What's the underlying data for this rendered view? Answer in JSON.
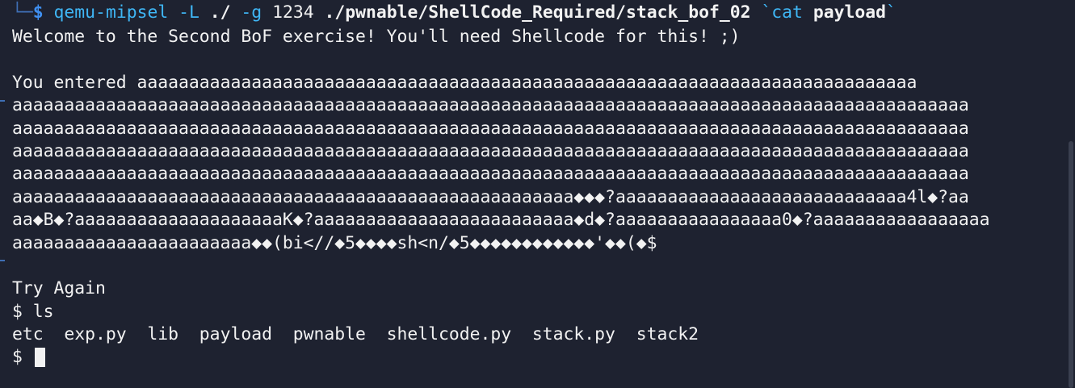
{
  "terminal": {
    "prompt_corner": "└─",
    "prompt_symbol": "$",
    "command": {
      "program": "qemu-mipsel",
      "flag_L": "-L",
      "path_L": "./",
      "flag_g": "-g",
      "port": "1234",
      "binary": "./pwnable/ShellCode_Required/stack_bof_02",
      "backtick_open": "`",
      "sub_cmd": "cat",
      "sub_arg": "payload",
      "backtick_close": "`"
    },
    "output_lines": [
      "Welcome to the Second BoF exercise! You'll need Shellcode for this! ;)",
      "",
      "You entered aaaaaaaaaaaaaaaaaaaaaaaaaaaaaaaaaaaaaaaaaaaaaaaaaaaaaaaaaaaaaaaaaaaaaaaaaaa",
      "aaaaaaaaaaaaaaaaaaaaaaaaaaaaaaaaaaaaaaaaaaaaaaaaaaaaaaaaaaaaaaaaaaaaaaaaaaaaaaaaaaaaaaaaaaaa",
      "aaaaaaaaaaaaaaaaaaaaaaaaaaaaaaaaaaaaaaaaaaaaaaaaaaaaaaaaaaaaaaaaaaaaaaaaaaaaaaaaaaaaaaaaaaaa",
      "aaaaaaaaaaaaaaaaaaaaaaaaaaaaaaaaaaaaaaaaaaaaaaaaaaaaaaaaaaaaaaaaaaaaaaaaaaaaaaaaaaaaaaaaaaaa",
      "aaaaaaaaaaaaaaaaaaaaaaaaaaaaaaaaaaaaaaaaaaaaaaaaaaaaaaaaaaaaaaaaaaaaaaaaaaaaaaaaaaaaaaaaaaaa",
      "aaaaaaaaaaaaaaaaaaaaaaaaaaaaaaaaaaaaaaaaaaaaaaaaaaaaaa◆◆◆?aaaaaaaaaaaaaaaaaaaaaaaaaaaa4l◆?aa",
      "aa◆B◆?aaaaaaaaaaaaaaaaaaaaK◆?aaaaaaaaaaaaaaaaaaaaaaaaa◆d◆?aaaaaaaaaaaaaaaa0◆?aaaaaaaaaaaaaaaaa",
      "aaaaaaaaaaaaaaaaaaaaaaa◆◆(bi<//◆5◆◆◆◆sh<n/◆5◆◆◆◆◆◆◆◆◆◆◆◆'◆◆(◆$",
      "",
      "Try Again",
      "$ ls",
      "etc  exp.py  lib  payload  pwnable  shellcode.py  stack.py  stack2"
    ],
    "final_prompt": "$ "
  }
}
